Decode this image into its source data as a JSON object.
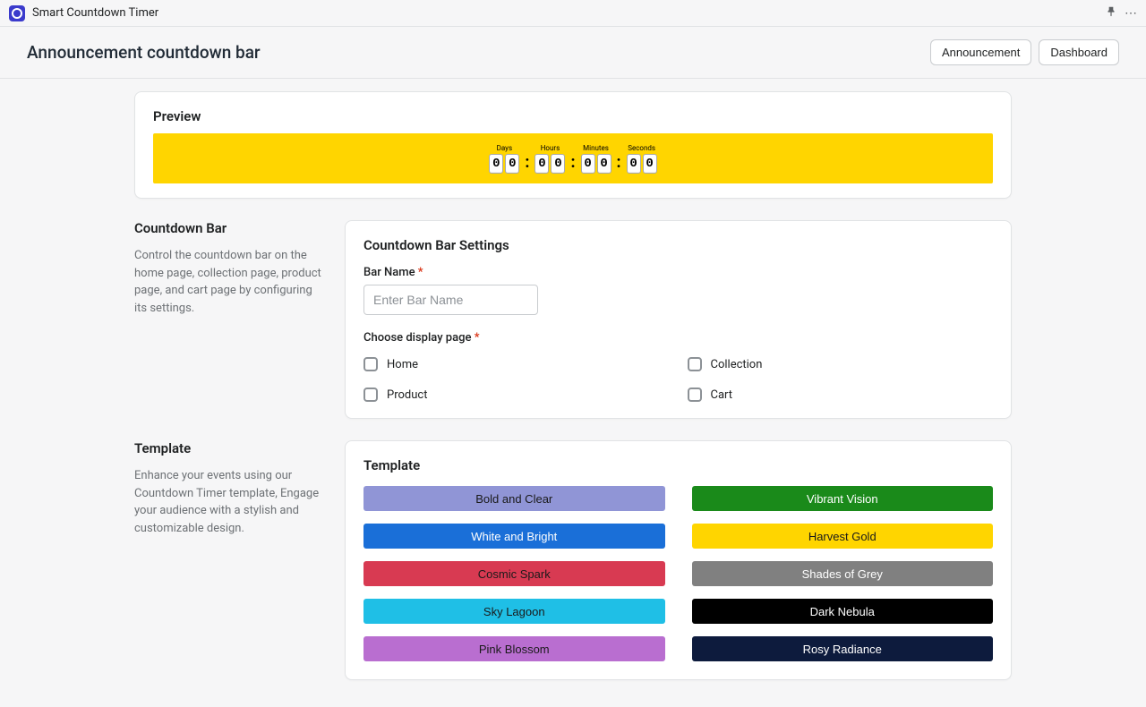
{
  "app": {
    "title": "Smart Countdown Timer"
  },
  "page": {
    "title": "Announcement countdown bar"
  },
  "header_buttons": {
    "announcement": "Announcement",
    "dashboard": "Dashboard"
  },
  "preview": {
    "title": "Preview",
    "bar_color": "#ffd500",
    "units": [
      {
        "label": "Days",
        "d1": "0",
        "d2": "0"
      },
      {
        "label": "Hours",
        "d1": "0",
        "d2": "0"
      },
      {
        "label": "Minutes",
        "d1": "0",
        "d2": "0"
      },
      {
        "label": "Seconds",
        "d1": "0",
        "d2": "0"
      }
    ]
  },
  "settings_side": {
    "title": "Countdown Bar",
    "desc": "Control the countdown bar on the home page, collection page, product page, and cart page by configuring its settings."
  },
  "settings": {
    "title": "Countdown Bar Settings",
    "bar_name_label": "Bar Name",
    "bar_name_placeholder": "Enter Bar Name",
    "display_page_label": "Choose display page",
    "pages": {
      "home": "Home",
      "collection": "Collection",
      "product": "Product",
      "cart": "Cart"
    }
  },
  "template_side": {
    "title": "Template",
    "desc": "Enhance your events using our Countdown Timer template, Engage your audience with a stylish and customizable design."
  },
  "template": {
    "title": "Template",
    "options": [
      {
        "label": "Bold and Clear",
        "bg": "#9095d6",
        "fg": "#1a1a1a"
      },
      {
        "label": "Vibrant Vision",
        "bg": "#1a8a1a",
        "fg": "#ffffff"
      },
      {
        "label": "White and Bright",
        "bg": "#1a6fd8",
        "fg": "#ffffff"
      },
      {
        "label": "Harvest Gold",
        "bg": "#ffd500",
        "fg": "#1a1a1a"
      },
      {
        "label": "Cosmic Spark",
        "bg": "#d83a52",
        "fg": "#1a1a1a"
      },
      {
        "label": "Shades of Grey",
        "bg": "#808080",
        "fg": "#ffffff"
      },
      {
        "label": "Sky Lagoon",
        "bg": "#1fbfe6",
        "fg": "#1a1a1a"
      },
      {
        "label": "Dark Nebula",
        "bg": "#000000",
        "fg": "#ffffff"
      },
      {
        "label": "Pink Blossom",
        "bg": "#b96ed0",
        "fg": "#1a1a1a"
      },
      {
        "label": "Rosy Radiance",
        "bg": "#0d1b3d",
        "fg": "#ffffff"
      }
    ]
  }
}
